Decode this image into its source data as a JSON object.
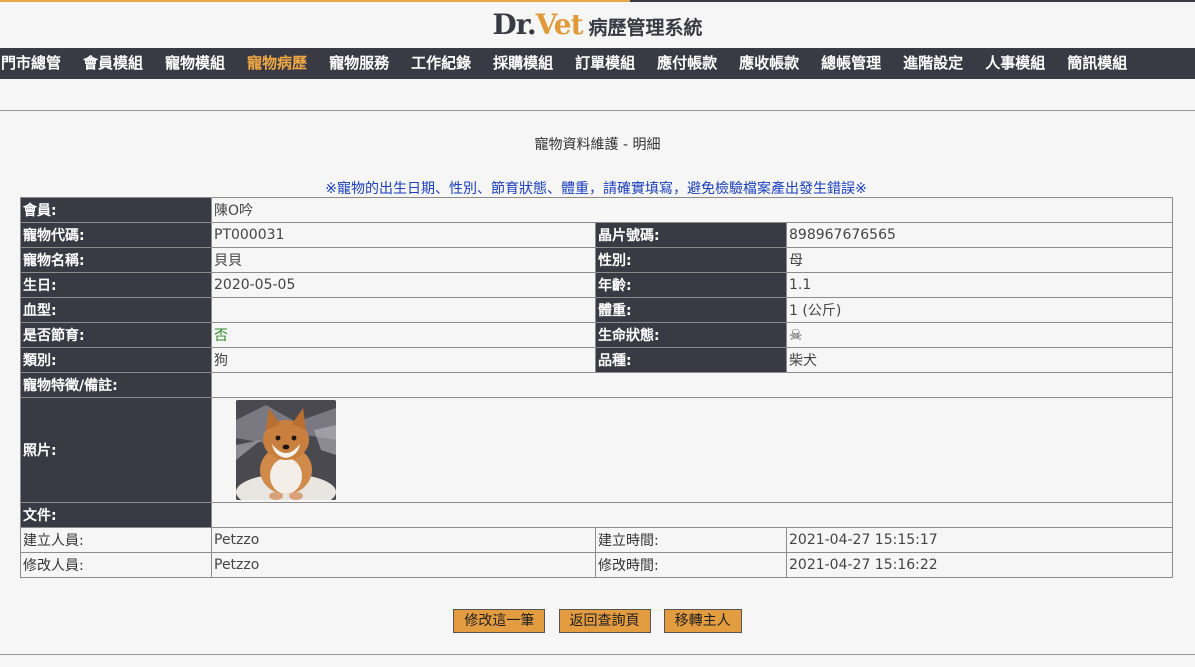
{
  "header": {
    "logo_dr": "Dr.",
    "logo_vet": "Vet",
    "system_title": "病歷管理系統"
  },
  "nav": {
    "items": [
      {
        "label": "門市總管"
      },
      {
        "label": "會員模組"
      },
      {
        "label": "寵物模組"
      },
      {
        "label": "寵物病歷",
        "active": true
      },
      {
        "label": "寵物服務"
      },
      {
        "label": "工作紀錄"
      },
      {
        "label": "採購模組"
      },
      {
        "label": "訂單模組"
      },
      {
        "label": "應付帳款"
      },
      {
        "label": "應收帳款"
      },
      {
        "label": "總帳管理"
      },
      {
        "label": "進階設定"
      },
      {
        "label": "人事模組"
      },
      {
        "label": "簡訊模組"
      }
    ]
  },
  "page": {
    "title": "寵物資料維護 - 明細",
    "notice": "※寵物的出生日期、性別、節育狀態、體重，請確實填寫，避免檢驗檔案產出發生錯誤※"
  },
  "pet": {
    "member_label": "會員:",
    "member_value": "陳O吟",
    "code_label": "寵物代碼:",
    "code_value": "PT000031",
    "chip_label": "晶片號碼:",
    "chip_value": "898967676565",
    "name_label": "寵物名稱:",
    "name_value": "貝貝",
    "gender_label": "性別:",
    "gender_value": "母",
    "birth_label": "生日:",
    "birth_value": "2020-05-05",
    "age_label": "年齡:",
    "age_value": "1.1",
    "blood_label": "血型:",
    "blood_value": "",
    "weight_label": "體重:",
    "weight_value": "1 (公斤)",
    "neutered_label": "是否節育:",
    "neutered_value": "否",
    "life_label": "生命狀態:",
    "life_icon": "skull-crossbones-icon",
    "type_label": "類別:",
    "type_value": "狗",
    "breed_label": "品種:",
    "breed_value": "柴犬",
    "notes_label": "寵物特徵/備註:",
    "notes_value": "",
    "photo_label": "照片:",
    "docs_label": "文件:",
    "docs_value": "",
    "created_by_label": "建立人員:",
    "created_by_value": "Petzzo",
    "created_time_label": "建立時間:",
    "created_time_value": "2021-04-27 15:15:17",
    "modified_by_label": "修改人員:",
    "modified_by_value": "Petzzo",
    "modified_time_label": "修改時間:",
    "modified_time_value": "2021-04-27 15:16:22"
  },
  "buttons": {
    "edit": "修改這一筆",
    "back": "返回查詢頁",
    "transfer": "移轉主人"
  },
  "colors": {
    "nav_bg": "#3a3a44",
    "accent": "#e39c3f",
    "notice": "#1a3fbf"
  }
}
